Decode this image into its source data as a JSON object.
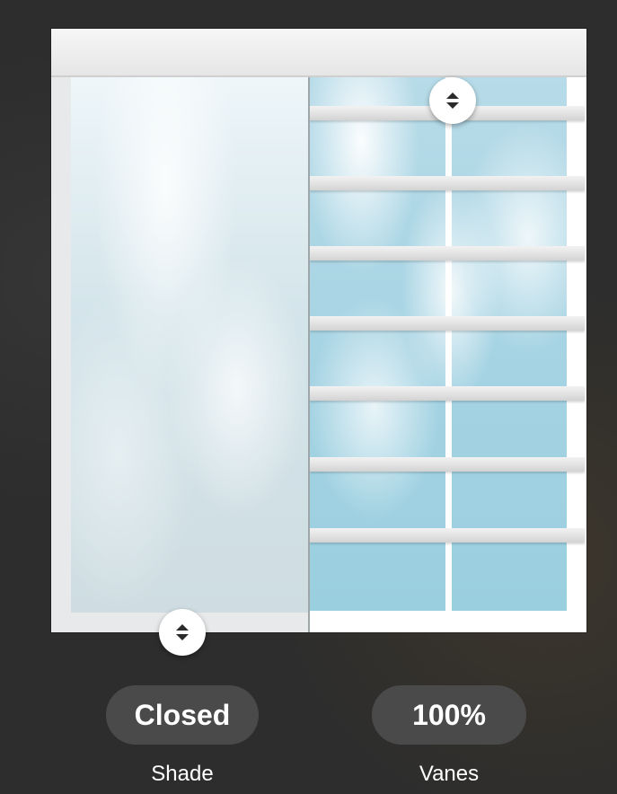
{
  "controls": {
    "shade": {
      "value": "Closed",
      "label": "Shade"
    },
    "vanes": {
      "value": "100%",
      "label": "Vanes"
    }
  },
  "icons": {
    "shade_handle": "up-down-arrows-icon",
    "vanes_handle": "up-down-arrows-icon"
  },
  "colors": {
    "background": "#2d2d2d",
    "pill": "#4a4a4a",
    "text": "#ffffff",
    "sky": "#a5d3e3"
  }
}
